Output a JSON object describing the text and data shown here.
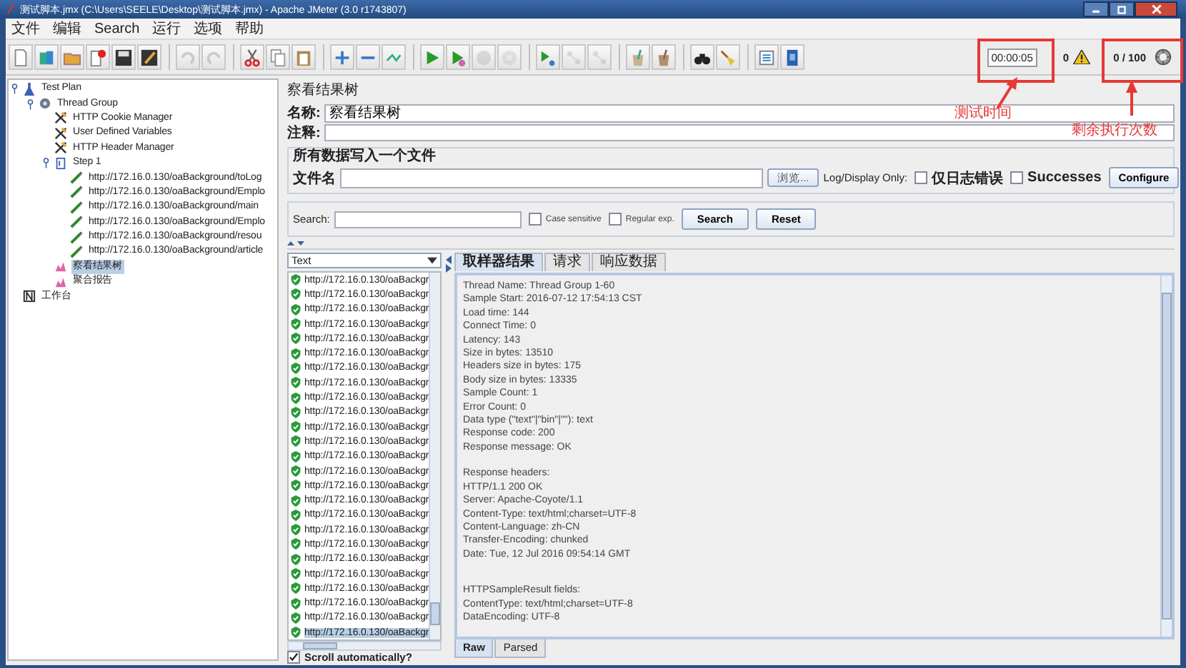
{
  "window": {
    "title": "测试脚本.jmx (C:\\Users\\SEELE\\Desktop\\测试脚本.jmx) - Apache JMeter (3.0 r1743807)"
  },
  "menu": [
    "文件",
    "编辑",
    "Search",
    "运行",
    "选项",
    "帮助"
  ],
  "toolbar": {
    "buttons": [
      {
        "kind": "new",
        "disabled": false
      },
      {
        "kind": "templates",
        "disabled": false
      },
      {
        "kind": "open",
        "disabled": false
      },
      {
        "kind": "close",
        "disabled": false
      },
      {
        "kind": "save",
        "disabled": false
      },
      {
        "kind": "save-as",
        "disabled": false
      },
      {
        "kind": "undo",
        "disabled": true
      },
      {
        "kind": "redo",
        "disabled": true
      },
      {
        "kind": "cut",
        "disabled": false
      },
      {
        "kind": "copy",
        "disabled": false
      },
      {
        "kind": "paste",
        "disabled": false
      },
      {
        "kind": "expand",
        "disabled": false
      },
      {
        "kind": "collapse",
        "disabled": false
      },
      {
        "kind": "toggle",
        "disabled": false
      },
      {
        "kind": "start",
        "disabled": false
      },
      {
        "kind": "start-no-pauses",
        "disabled": false
      },
      {
        "kind": "stop",
        "disabled": true
      },
      {
        "kind": "shutdown",
        "disabled": true
      },
      {
        "kind": "remote-start",
        "disabled": false
      },
      {
        "kind": "remote-stop",
        "disabled": true
      },
      {
        "kind": "remote-shutdown",
        "disabled": true
      },
      {
        "kind": "clear",
        "disabled": false
      },
      {
        "kind": "clear-all",
        "disabled": false
      },
      {
        "kind": "search",
        "disabled": false
      },
      {
        "kind": "reset-search",
        "disabled": false
      },
      {
        "kind": "function-helper",
        "disabled": false
      },
      {
        "kind": "help",
        "disabled": false
      }
    ],
    "timer": "00:00:05",
    "error_count": "0",
    "threads": "0 / 100"
  },
  "annotations": [
    {
      "label": "测试时间"
    },
    {
      "label": "剩余执行次数"
    }
  ],
  "tree": [
    {
      "label": "Test Plan",
      "kind": "plan",
      "expanded": true,
      "selected": false,
      "children": [
        {
          "label": "Thread Group",
          "kind": "thread-group",
          "expanded": true,
          "selected": false,
          "children": [
            {
              "label": "HTTP Cookie Manager",
              "kind": "config",
              "selected": false
            },
            {
              "label": "User Defined Variables",
              "kind": "config",
              "selected": false
            },
            {
              "label": "HTTP Header Manager",
              "kind": "config",
              "selected": false
            },
            {
              "label": "Step 1",
              "kind": "controller",
              "expanded": true,
              "selected": false,
              "children": [
                {
                  "label": "http://172.16.0.130/oaBackground/toLog",
                  "kind": "sampler",
                  "selected": false
                },
                {
                  "label": "http://172.16.0.130/oaBackground/Emplo",
                  "kind": "sampler",
                  "selected": false
                },
                {
                  "label": "http://172.16.0.130/oaBackground/main",
                  "kind": "sampler",
                  "selected": false
                },
                {
                  "label": "http://172.16.0.130/oaBackground/Emplo",
                  "kind": "sampler",
                  "selected": false
                },
                {
                  "label": "http://172.16.0.130/oaBackground/resou",
                  "kind": "sampler",
                  "selected": false
                },
                {
                  "label": "http://172.16.0.130/oaBackground/article",
                  "kind": "sampler",
                  "selected": false
                }
              ]
            },
            {
              "label": "察看结果树",
              "kind": "listener",
              "selected": true
            },
            {
              "label": "聚合报告",
              "kind": "listener",
              "selected": false
            }
          ]
        }
      ]
    },
    {
      "label": "工作台",
      "kind": "workbench",
      "selected": false
    }
  ],
  "panel": {
    "title": "察看结果树",
    "name_label": "名称:",
    "name_value": "察看结果树",
    "comment_label": "注释:",
    "file_group": {
      "legend": "所有数据写入一个文件",
      "file_label": "文件名",
      "browse": "浏览...",
      "log_label": "Log/Display Only:",
      "checks": [
        {
          "label": "仅日志错误",
          "checked": false
        },
        {
          "label": "Successes",
          "checked": false
        }
      ],
      "configure": "Configure"
    },
    "search": {
      "label": "Search:",
      "checks": [
        {
          "label": "Case sensitive",
          "checked": false
        },
        {
          "label": "Regular exp.",
          "checked": false
        }
      ],
      "search_button": "Search",
      "reset_button": "Reset"
    },
    "renderer": "Text",
    "results": [
      {
        "label": "http://172.16.0.130/oaBackgr",
        "success": true,
        "selected": false
      },
      {
        "label": "http://172.16.0.130/oaBackgr",
        "success": true,
        "selected": false
      },
      {
        "label": "http://172.16.0.130/oaBackgr",
        "success": true,
        "selected": false
      },
      {
        "label": "http://172.16.0.130/oaBackgr",
        "success": true,
        "selected": false
      },
      {
        "label": "http://172.16.0.130/oaBackgr",
        "success": true,
        "selected": false
      },
      {
        "label": "http://172.16.0.130/oaBackgr",
        "success": true,
        "selected": false
      },
      {
        "label": "http://172.16.0.130/oaBackgr",
        "success": true,
        "selected": false
      },
      {
        "label": "http://172.16.0.130/oaBackgr",
        "success": true,
        "selected": false
      },
      {
        "label": "http://172.16.0.130/oaBackgr",
        "success": true,
        "selected": false
      },
      {
        "label": "http://172.16.0.130/oaBackgr",
        "success": true,
        "selected": false
      },
      {
        "label": "http://172.16.0.130/oaBackgr",
        "success": true,
        "selected": false
      },
      {
        "label": "http://172.16.0.130/oaBackgr",
        "success": true,
        "selected": false
      },
      {
        "label": "http://172.16.0.130/oaBackgr",
        "success": true,
        "selected": false
      },
      {
        "label": "http://172.16.0.130/oaBackgr",
        "success": true,
        "selected": false
      },
      {
        "label": "http://172.16.0.130/oaBackgr",
        "success": true,
        "selected": false
      },
      {
        "label": "http://172.16.0.130/oaBackgr",
        "success": true,
        "selected": false
      },
      {
        "label": "http://172.16.0.130/oaBackgr",
        "success": true,
        "selected": false
      },
      {
        "label": "http://172.16.0.130/oaBackgr",
        "success": true,
        "selected": false
      },
      {
        "label": "http://172.16.0.130/oaBackgr",
        "success": true,
        "selected": false
      },
      {
        "label": "http://172.16.0.130/oaBackgr",
        "success": true,
        "selected": false
      },
      {
        "label": "http://172.16.0.130/oaBackgr",
        "success": true,
        "selected": false
      },
      {
        "label": "http://172.16.0.130/oaBackgr",
        "success": true,
        "selected": false
      },
      {
        "label": "http://172.16.0.130/oaBackgr",
        "success": true,
        "selected": false
      },
      {
        "label": "http://172.16.0.130/oaBackgr",
        "success": true,
        "selected": false
      },
      {
        "label": "http://172.16.0.130/oaBackgr",
        "success": true,
        "selected": true
      }
    ],
    "scroll_auto": {
      "label": "Scroll automatically?",
      "checked": true
    },
    "tabs": [
      {
        "label": "取样器结果",
        "selected": true
      },
      {
        "label": "请求",
        "selected": false
      },
      {
        "label": "响应数据",
        "selected": false
      }
    ],
    "blocks": [
      [
        "Thread Name: Thread Group 1-60",
        "Sample Start: 2016-07-12 17:54:13 CST",
        "Load time: 144",
        "Connect Time: 0",
        "Latency: 143",
        "Size in bytes: 13510",
        "Headers size in bytes: 175",
        "Body size in bytes: 13335",
        "Sample Count: 1",
        "Error Count: 0",
        "Data type (\"text\"|\"bin\"|\"\"): text",
        "Response code: 200",
        "Response message: OK"
      ],
      [
        "Response headers:",
        "HTTP/1.1 200 OK",
        "Server: Apache-Coyote/1.1",
        "Content-Type: text/html;charset=UTF-8",
        "Content-Language: zh-CN",
        "Transfer-Encoding: chunked",
        "Date: Tue, 12 Jul 2016 09:54:14 GMT"
      ],
      [
        "HTTPSampleResult fields:",
        "ContentType: text/html;charset=UTF-8",
        "DataEncoding: UTF-8"
      ]
    ],
    "bottom_tabs": [
      {
        "label": "Raw",
        "selected": true
      },
      {
        "label": "Parsed",
        "selected": false
      }
    ]
  }
}
